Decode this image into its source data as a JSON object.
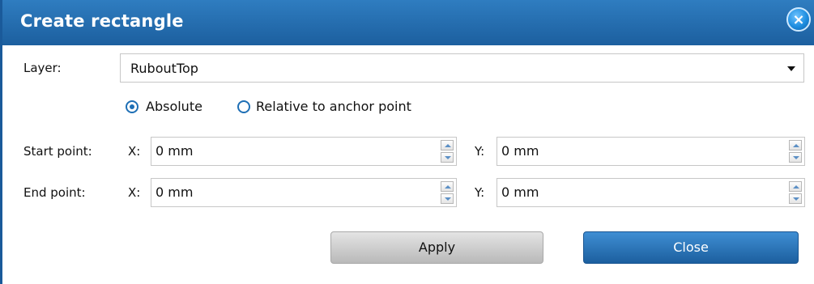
{
  "dialog": {
    "title": "Create rectangle",
    "close_icon": "×"
  },
  "layer": {
    "label": "Layer:",
    "value": "RuboutTop"
  },
  "mode": {
    "absolute_label": "Absolute",
    "relative_label": "Relative to anchor point",
    "selected": "Absolute"
  },
  "start_point": {
    "label": "Start point:",
    "x_label": "X:",
    "x_value": "0 mm",
    "y_label": "Y:",
    "y_value": "0 mm"
  },
  "end_point": {
    "label": "End point:",
    "x_label": "X:",
    "x_value": "0 mm",
    "y_label": "Y:",
    "y_value": "0 mm"
  },
  "buttons": {
    "apply": "Apply",
    "close": "Close"
  },
  "colors": {
    "title_bar": "#1c5f9f",
    "radio_accent": "#1e6fb5",
    "close_button": "#1c5f9f"
  }
}
